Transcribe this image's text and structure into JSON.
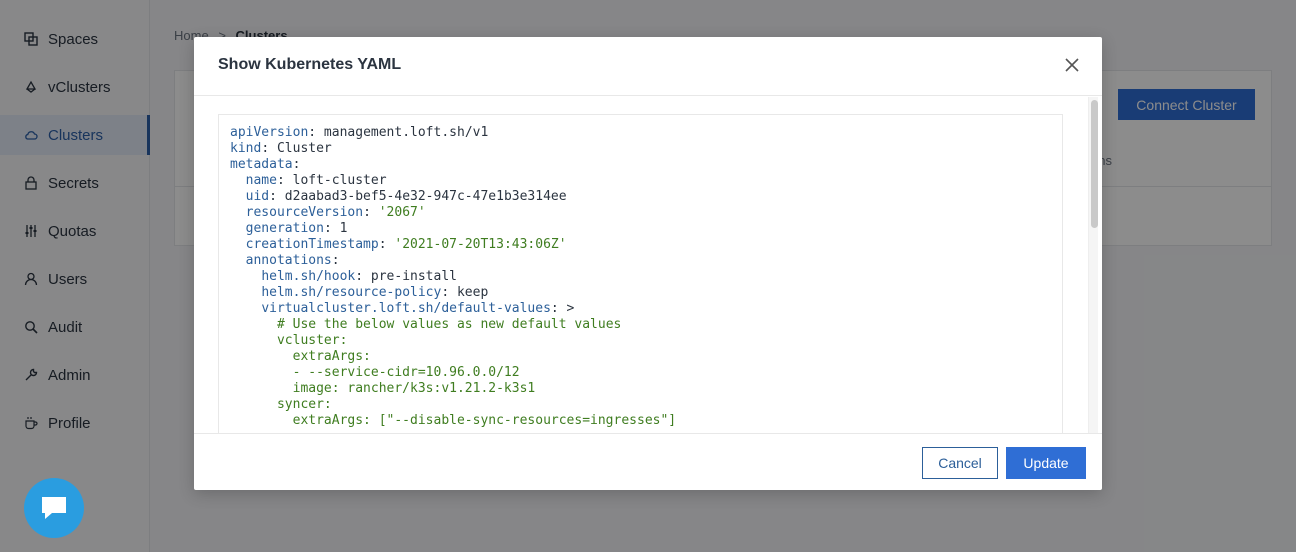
{
  "sidebar": {
    "items": [
      {
        "label": "Spaces",
        "icon": "spaces-icon"
      },
      {
        "label": "vClusters",
        "icon": "vcluster-icon"
      },
      {
        "label": "Clusters",
        "icon": "cloud-icon",
        "active": true
      },
      {
        "label": "Secrets",
        "icon": "lock-icon"
      },
      {
        "label": "Quotas",
        "icon": "sliders-icon"
      },
      {
        "label": "Users",
        "icon": "user-icon"
      },
      {
        "label": "Audit",
        "icon": "search-icon"
      },
      {
        "label": "Admin",
        "icon": "wrench-icon"
      },
      {
        "label": "Profile",
        "icon": "coffee-icon"
      }
    ]
  },
  "breadcrumb": {
    "home": "Home",
    "sep": ">",
    "current": "Clusters"
  },
  "page": {
    "connect_label": "Connect Cluster",
    "col_label": "ons"
  },
  "modal": {
    "title": "Show Kubernetes YAML",
    "cancel_label": "Cancel",
    "update_label": "Update"
  },
  "colors": {
    "accent": "#2f6ed5",
    "active_bg": "#e3ecf7",
    "chat": "#2a9de0"
  }
}
